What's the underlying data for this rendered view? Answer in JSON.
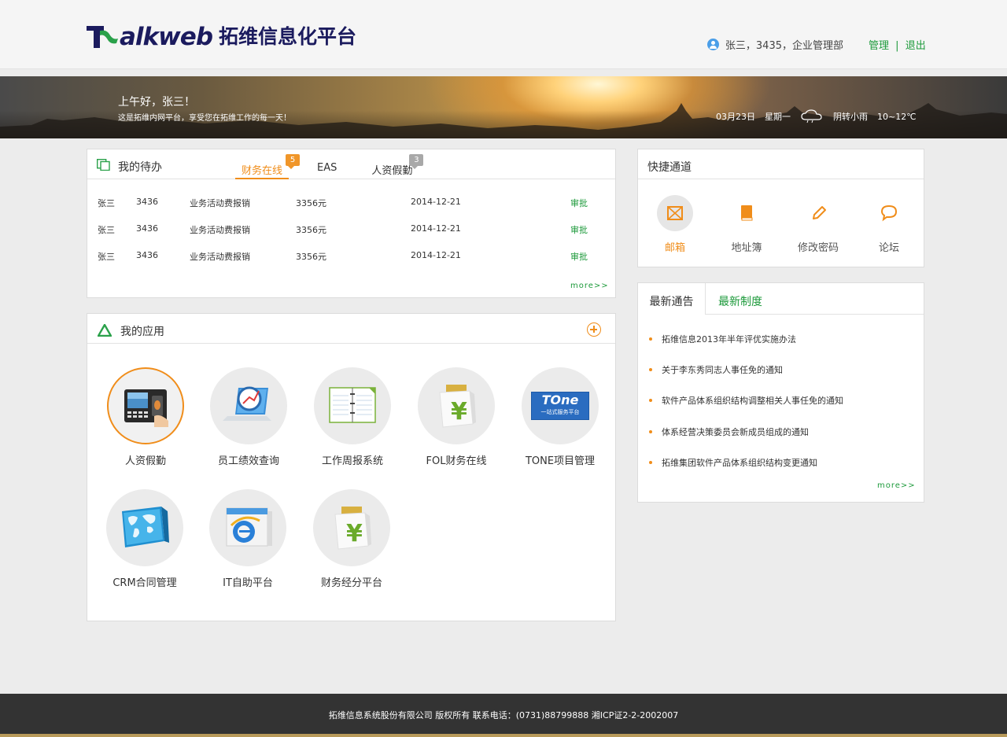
{
  "header": {
    "logo_word": "alkweb",
    "logo_cn": "拓维信息化平台",
    "user_info": "张三，3435，企业管理部",
    "link_manage": "管理",
    "link_sep": "|",
    "link_logout": "退出"
  },
  "banner": {
    "greeting": "上午好，张三！",
    "subtitle": "这是拓维内网平台，享受您在拓维工作的每一天！",
    "date": "03月23日",
    "weekday": "星期一",
    "weather": "阴转小雨",
    "temperature": "10~12℃"
  },
  "todo": {
    "title": "我的待办",
    "tabs": [
      {
        "label": "财务在线",
        "badge": "5"
      },
      {
        "label": "EAS",
        "badge": ""
      },
      {
        "label": "人资假勤",
        "badge": "3"
      }
    ],
    "rows": [
      {
        "name": "张三",
        "id": "3436",
        "type": "业务活动费报销",
        "amount": "3356元",
        "date": "2014-12-21",
        "action": "审批"
      },
      {
        "name": "张三",
        "id": "3436",
        "type": "业务活动费报销",
        "amount": "3356元",
        "date": "2014-12-21",
        "action": "审批"
      },
      {
        "name": "张三",
        "id": "3436",
        "type": "业务活动费报销",
        "amount": "3356元",
        "date": "2014-12-21",
        "action": "审批"
      }
    ],
    "more": "more>>"
  },
  "apps": {
    "title": "我的应用",
    "items": [
      {
        "label": "人资假勤",
        "icon": "attendance-machine-icon"
      },
      {
        "label": "员工绩效查询",
        "icon": "performance-laptop-icon"
      },
      {
        "label": "工作周报系统",
        "icon": "notebook-icon"
      },
      {
        "label": "FOL财务在线",
        "icon": "finance-yen-icon"
      },
      {
        "label": "TONE项目管理",
        "icon": "tone-logo-icon"
      },
      {
        "label": "CRM合同管理",
        "icon": "world-map-icon"
      },
      {
        "label": "IT自助平台",
        "icon": "ie-browser-icon"
      },
      {
        "label": "财务经分平台",
        "icon": "finance-yen-icon"
      }
    ],
    "tone_text": "TOne",
    "tone_sub": "一站式服务平台"
  },
  "quick": {
    "title": "快捷通道",
    "items": [
      {
        "label": "邮箱",
        "icon": "mail-icon"
      },
      {
        "label": "地址簿",
        "icon": "address-book-icon"
      },
      {
        "label": "修改密码",
        "icon": "pencil-icon"
      },
      {
        "label": "论坛",
        "icon": "chat-bubble-icon"
      }
    ]
  },
  "notice": {
    "tab_active": "最新通告",
    "tab_other": "最新制度",
    "items": [
      "拓维信息2013年半年评优实施办法",
      "关于李东秀同志人事任免的通知",
      "软件产品体系组织结构调整相关人事任免的通知",
      "体系经营决策委员会新成员组成的通知",
      "拓维集团软件产品体系组织结构变更通知"
    ],
    "more": "more>>"
  },
  "footer": {
    "text": "拓维信息系统股份有限公司 版权所有 联系电话：(0731)88799888 湘ICP证2-2-2002007"
  },
  "colors": {
    "accent_orange": "#f08d1a",
    "accent_green": "#1d9a3b",
    "brand_navy": "#1b1b5e"
  }
}
